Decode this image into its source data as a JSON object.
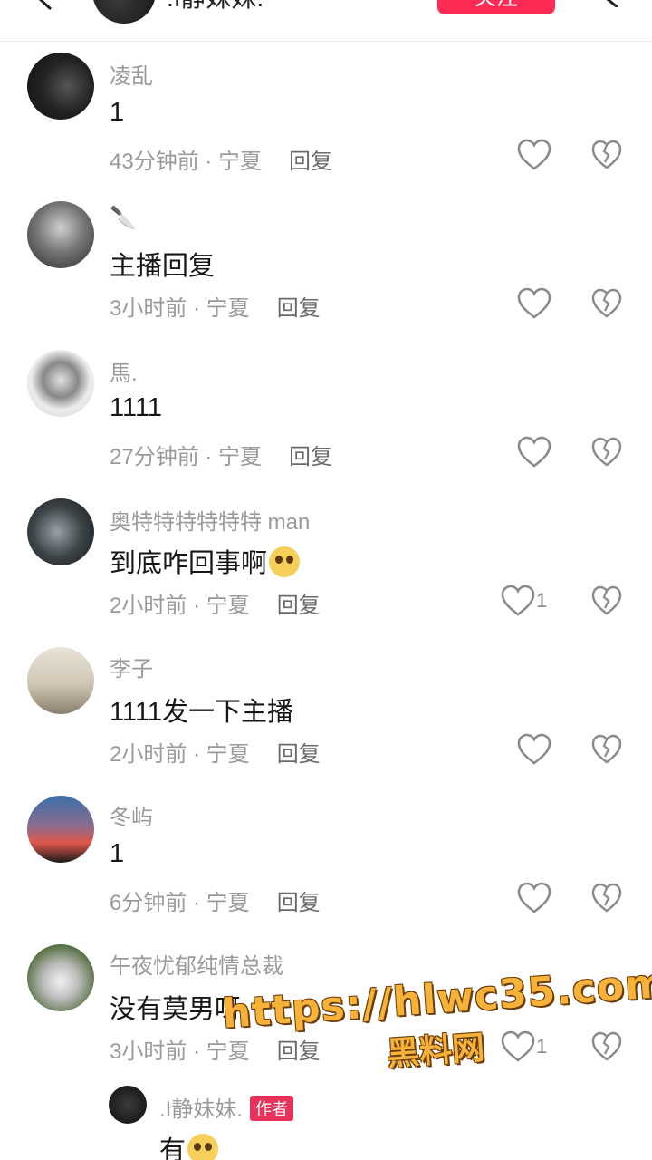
{
  "header": {
    "title": ".I静妹妹.",
    "follow_label": "关注"
  },
  "comments": [
    {
      "user": "凌乱",
      "text": "1",
      "time": "43分钟前 · 宁夏",
      "reply": "回复",
      "likes": ""
    },
    {
      "user": "🔪",
      "text": "主播回复",
      "time": "3小时前 · 宁夏",
      "reply": "回复",
      "likes": ""
    },
    {
      "user": "馬.",
      "text": "1111",
      "time": "27分钟前 · 宁夏",
      "reply": "回复",
      "likes": ""
    },
    {
      "user": "奥特特特特特特 man",
      "text": "到底咋回事啊",
      "time": "2小时前 · 宁夏",
      "reply": "回复",
      "likes": "1"
    },
    {
      "user": "李子",
      "text": "1111发一下主播",
      "time": "2小时前 · 宁夏",
      "reply": "回复",
      "likes": ""
    },
    {
      "user": "冬屿",
      "text": "1",
      "time": "6分钟前 · 宁夏",
      "reply": "回复",
      "likes": ""
    },
    {
      "user": "午夜忧郁纯情总裁",
      "text": "没有莫男呀",
      "time": "3小时前 · 宁夏",
      "reply": "回复",
      "likes": "1"
    }
  ],
  "author_reply": {
    "user": ".I静妹妹.",
    "tag": "作者",
    "text": "有"
  },
  "watermark": {
    "url": "https://hlwc35.com",
    "label": "黑料网"
  },
  "colors": {
    "accent": "#fe2c55",
    "author_tag": "#e8345a",
    "meta_text": "#9a9a9a",
    "watermark": "#f7b23a"
  }
}
